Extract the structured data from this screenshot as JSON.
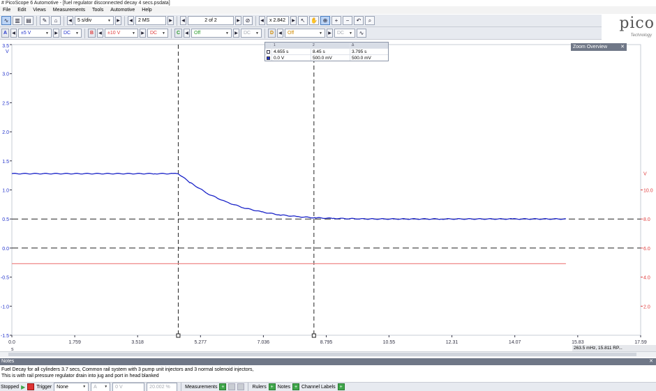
{
  "window": {
    "title": "# PicoScope 6 Automotive - [fuel regulator disconnected decay 4 secs.psdata]"
  },
  "menu": [
    "File",
    "Edit",
    "Views",
    "Measurements",
    "Tools",
    "Automotive",
    "Help"
  ],
  "toolbar": {
    "timebase": "5 s/div",
    "samples": "2 MS",
    "buffer": "2 of 2",
    "zoom": "x 2.842"
  },
  "channels": {
    "a": {
      "label": "A",
      "range": "±5 V",
      "coupling": "DC",
      "color": "#2233cc"
    },
    "b": {
      "label": "B",
      "range": "±10 V",
      "coupling": "DC",
      "color": "#e03c3c"
    },
    "c": {
      "label": "C",
      "range": "Off",
      "coupling": "DC",
      "color": "#2a9a2a"
    },
    "d": {
      "label": "D",
      "range": "Off",
      "coupling": "DC",
      "color": "#d08a00"
    }
  },
  "logo": {
    "word": "pico",
    "sub": "Technology"
  },
  "measurements": {
    "headers": [
      "1",
      "2",
      "Δ"
    ],
    "rows": [
      {
        "c1": "4.655 s",
        "c2": "8.45 s",
        "c3": "3.795 s"
      },
      {
        "c1": "0.0 V",
        "c2": "500.0 mV",
        "c3": "500.0 mV"
      }
    ]
  },
  "zoom_overview": {
    "title": "Zoom Overview"
  },
  "chart_data": {
    "type": "line",
    "x_unit": "s",
    "left_axis": {
      "unit": "V",
      "min": -1.5,
      "max": 3.5,
      "ticks": [
        "3.5",
        "3.0",
        "2.5",
        "2.0",
        "1.5",
        "1.0",
        "0.5",
        "0.0",
        "-0.5",
        "-1.0",
        "-1.5"
      ]
    },
    "right_axis": {
      "unit": "V",
      "ticks": [
        "10.0",
        "8.0",
        "6.0",
        "4.0",
        "2.0"
      ]
    },
    "x_axis": {
      "min": 0,
      "max": 17.59,
      "ticks": [
        "0.0",
        "1.759",
        "3.518",
        "5.277",
        "7.036",
        "8.795",
        "10.55",
        "12.31",
        "14.07",
        "15.83",
        "17.59"
      ]
    },
    "series": [
      {
        "name": "A",
        "color": "#1a23c8",
        "x": [
          0,
          4,
          4.5,
          4.655,
          5.0,
          5.5,
          6.0,
          6.5,
          7.0,
          7.5,
          8.0,
          8.5,
          9.0,
          10,
          12,
          14,
          15.5
        ],
        "y": [
          1.28,
          1.28,
          1.28,
          1.28,
          1.12,
          0.93,
          0.79,
          0.69,
          0.62,
          0.57,
          0.54,
          0.52,
          0.51,
          0.5,
          0.5,
          0.5,
          0.5
        ]
      },
      {
        "name": "B",
        "color": "#f08888",
        "x": [
          0,
          15.5
        ],
        "y": [
          -0.27,
          -0.27
        ]
      }
    ],
    "rulers": {
      "time": [
        4.655,
        8.45
      ],
      "voltage": [
        0.5,
        0.0
      ]
    }
  },
  "status_readout": "263.5 mHz, 15.811 RP...",
  "notes": {
    "title": "Notes",
    "lines": [
      "Fuel Decay for all cylinders 3.7 secs, Common rail system with 3 pump unit injectors and 3 normal solenoid injectors,",
      "This is with rail pressure regulator drain into jug and port in head blanked"
    ]
  },
  "bottom": {
    "status": "Stopped",
    "trigger_label": "Trigger",
    "trigger_mode": "None",
    "trigger_channel": "A",
    "trigger_level": "0 V",
    "pretrigger": "20.002 %",
    "measurements": "Measurements",
    "rulers": "Rulers",
    "notes": "Notes",
    "channel_labels": "Channel Labels"
  }
}
